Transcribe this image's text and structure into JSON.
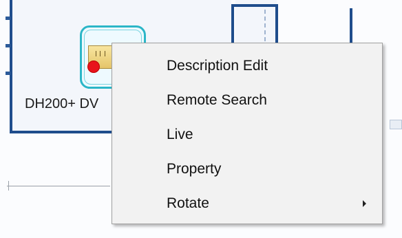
{
  "device": {
    "label": "DH200+ DV",
    "icon": "dvr-device-icon",
    "status_color": "#e8141c",
    "selection_color": "#2bb6c7"
  },
  "context_menu": {
    "items": [
      {
        "label": "Description Edit",
        "has_submenu": false
      },
      {
        "label": "Remote Search",
        "has_submenu": false
      },
      {
        "label": "Live",
        "has_submenu": false
      },
      {
        "label": "Property",
        "has_submenu": false
      },
      {
        "label": "Rotate",
        "has_submenu": true
      }
    ]
  },
  "colors": {
    "wall": "#1f4d8c",
    "menu_background": "#f2f2f2",
    "menu_border": "#a0a0a0"
  }
}
